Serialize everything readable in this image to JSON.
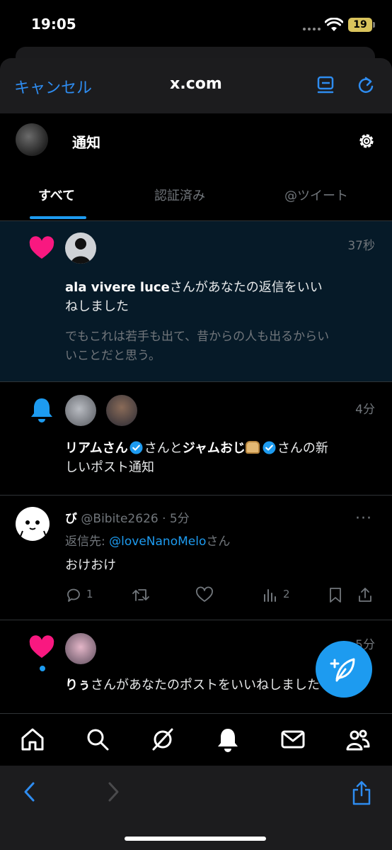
{
  "status": {
    "time": "19:05",
    "battery": "19"
  },
  "browser": {
    "cancel": "キャンセル",
    "url": "x.com"
  },
  "header": {
    "title": "通知"
  },
  "tabs": [
    "すべて",
    "認証済み",
    "@ツイート"
  ],
  "notifications": [
    {
      "time": "37秒",
      "user": "ala vivere luce",
      "text": "さんがあなたの返信をいいねしました",
      "quote": "でもこれは若手も出て、昔からの人も出るからいいことだと思う。"
    },
    {
      "time": "4分",
      "user1": "リアムさん",
      "mid": "さんと",
      "user2": "ジャムおじ",
      "end": "さんの新しいポスト通知"
    },
    {
      "name": "び",
      "handle": "@Bibite2626",
      "sep": "·",
      "time": "5分",
      "more": "···",
      "reply_prefix": "返信先: ",
      "reply_user": "@loveNanoMelo",
      "reply_suffix": "さん",
      "text": "おけおけ",
      "replies": "1",
      "views": "2"
    },
    {
      "time": "5分",
      "user": "りぅ",
      "text": "さんがあなたのポストをいいねしました"
    }
  ],
  "colors": {
    "accent": "#1d9bf0",
    "like": "#f91880",
    "browser_blue": "#2e8cf0"
  }
}
